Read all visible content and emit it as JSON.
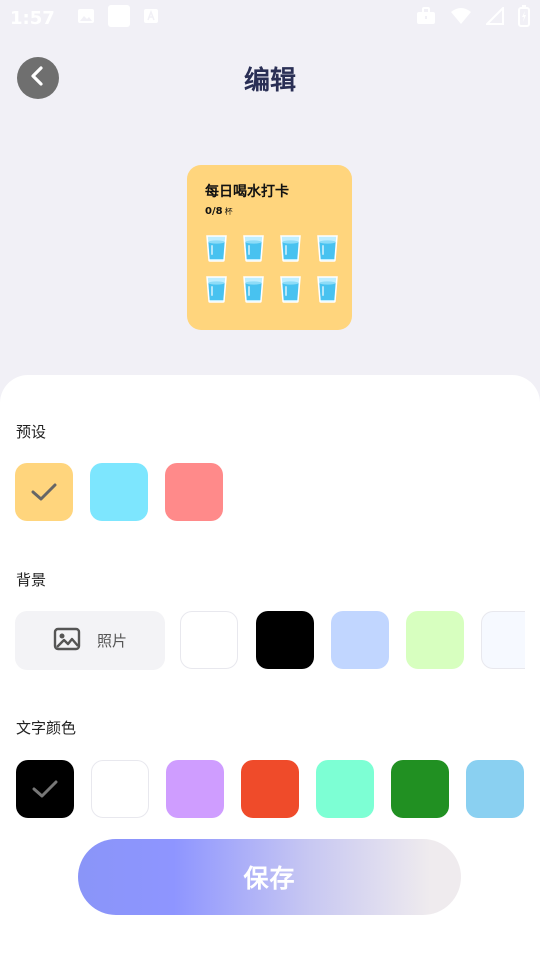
{
  "status_bar": {
    "time": "1:57",
    "icons": [
      "image-icon",
      "square-icon",
      "a-icon",
      "briefcase-icon",
      "wifi-icon",
      "signal-icon",
      "battery-icon"
    ]
  },
  "header": {
    "title": "编辑",
    "back_icon": "chevron-left-icon"
  },
  "widget": {
    "title": "每日喝水打卡",
    "count": "0/8",
    "unit": "杯",
    "cups": 8,
    "background": "#ffd57d"
  },
  "sections": {
    "preset_label": "预设",
    "background_label": "背景",
    "text_color_label": "文字颜色"
  },
  "presets": [
    {
      "color": "#ffd57d",
      "selected": true
    },
    {
      "color": "#7de6fe",
      "selected": false
    },
    {
      "color": "#ff8a8a",
      "selected": false
    }
  ],
  "background": {
    "photo_label": "照片",
    "photo_icon": "image-icon",
    "colors": [
      "#ffffff",
      "#000000",
      "#c1d6ff",
      "#d7ffbf",
      "#f6f9ff"
    ]
  },
  "text_colors": [
    {
      "color": "#000000",
      "selected": true
    },
    {
      "color": "#ffffff",
      "selected": false
    },
    {
      "color": "#cf9dff",
      "selected": false
    },
    {
      "color": "#ef4b2a",
      "selected": false
    },
    {
      "color": "#7dffd4",
      "selected": false
    },
    {
      "color": "#219022",
      "selected": false
    },
    {
      "color": "#8ad0f1",
      "selected": false
    }
  ],
  "save_button": {
    "label": "保存"
  }
}
